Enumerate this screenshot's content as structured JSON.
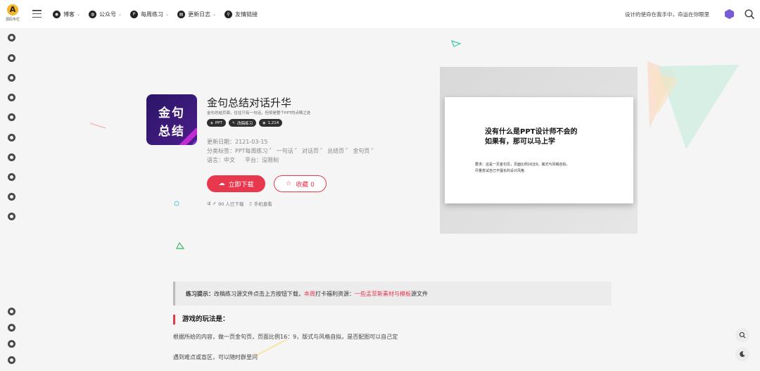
{
  "site": {
    "logo_text": "源码专栏"
  },
  "nav": {
    "items": [
      {
        "label": "博客",
        "icon": "compass-icon",
        "glyph": "◉"
      },
      {
        "label": "公众号",
        "icon": "wechat-icon",
        "glyph": "◍"
      },
      {
        "label": "每周练习",
        "icon": "p-badge-icon",
        "glyph": "P"
      },
      {
        "label": "更新日志",
        "icon": "document-icon",
        "glyph": "▤"
      },
      {
        "label": "友情链接",
        "icon": "link-icon",
        "glyph": "⚲"
      }
    ],
    "slogan": "设计的使命在我手中，命运在你眼里"
  },
  "product": {
    "title": "金句总结对话升华",
    "subtitle": "金句总结页面，往往只有一句话，但却是整个PPT的点睛之处",
    "thumb_line1": "金句",
    "thumb_line2": "总结",
    "tags": [
      {
        "icon": "diamond-icon",
        "glyph": "◈",
        "label": "PPT"
      },
      {
        "icon": "edit-icon",
        "glyph": "✎",
        "label": "改稿练习"
      },
      {
        "icon": "eye-icon",
        "glyph": "◉",
        "label": "1,214"
      }
    ],
    "update_label": "更新日期：",
    "update_date": "2121-03-15",
    "category_label": "分类标签：",
    "categories": [
      "PPT每周练习",
      "一句话",
      "对话页",
      "总结页",
      "金句页"
    ],
    "language_label": "语言：",
    "language": "中文",
    "platform_label": "平台：",
    "platform": "没限制",
    "download_label": "立即下载",
    "favorite_label": "收藏 0",
    "stats": {
      "downloads": "90 人已下载",
      "mobile": "手机查看"
    }
  },
  "preview": {
    "headline1": "没有什么是PPT设计师不会的",
    "headline2": "如果有，那可以马上学",
    "requirement1": "要求：这是一页金句页，页面比例16比9，版式与风格自拟，",
    "requirement2": "尽量尝试自己不擅长的设计风格"
  },
  "tip": {
    "bold": "练习提示：",
    "text1": "改稿练习源文件点击上方按钮下载，",
    "red1": "本周",
    "text2": "打卡福利资源：",
    "red2": "一些孟菲斯素材与模板",
    "text3": "源文件"
  },
  "section": {
    "title": "游戏的玩法是：",
    "para1": "根据所给的内容，做一页金句页，页面比例16：9，版式与风格自拟，是否配图可以自己定",
    "para2": "遇到难点或盲区，可以随时群里问"
  },
  "colors": {
    "accent": "#e8384e",
    "thumb_bg": "#2a1466",
    "tag_bg": "#2f2f2f"
  }
}
